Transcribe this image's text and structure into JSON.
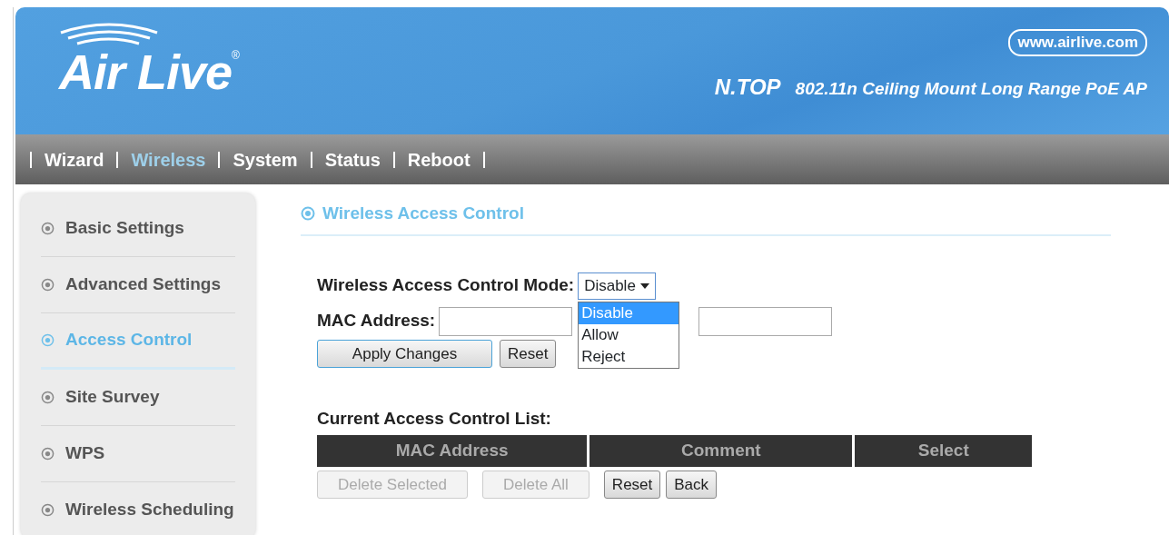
{
  "header": {
    "logo": "Air Live",
    "registered": "®",
    "website": "www.airlive.com",
    "model": "N.TOP",
    "product": "802.11n Ceiling Mount Long Range PoE AP"
  },
  "nav": [
    {
      "label": "Wizard",
      "selected": false
    },
    {
      "label": "Wireless",
      "selected": true
    },
    {
      "label": "System",
      "selected": false
    },
    {
      "label": "Status",
      "selected": false
    },
    {
      "label": "Reboot",
      "selected": false
    }
  ],
  "sidebar": [
    {
      "label": "Basic Settings",
      "selected": false
    },
    {
      "label": "Advanced Settings",
      "selected": false
    },
    {
      "label": "Access Control",
      "selected": true
    },
    {
      "label": "Site Survey",
      "selected": false
    },
    {
      "label": "WPS",
      "selected": false
    },
    {
      "label": "Wireless Scheduling",
      "selected": false
    }
  ],
  "section_title": "Wireless Access Control",
  "form": {
    "mode_label": "Wireless Access Control Mode:",
    "mode_value": "Disable",
    "expanded": true,
    "mode_options": [
      {
        "label": "Disable",
        "selected": true
      },
      {
        "label": "Allow",
        "selected": false
      },
      {
        "label": "Reject",
        "selected": false
      }
    ],
    "mac_label": "MAC Address:",
    "buttons": [
      {
        "label": "Apply Changes",
        "kind": "primary"
      },
      {
        "label": "Reset",
        "kind": "normal"
      }
    ]
  },
  "list": {
    "title": "Current Access Control List:",
    "columns": [
      "MAC Address",
      "Comment",
      "Select"
    ],
    "buttons": [
      {
        "label": "Delete Selected",
        "disabled": true
      },
      {
        "label": "Delete All",
        "disabled": true
      },
      {
        "label": "Reset",
        "disabled": false
      },
      {
        "label": "Back",
        "disabled": false
      }
    ]
  }
}
